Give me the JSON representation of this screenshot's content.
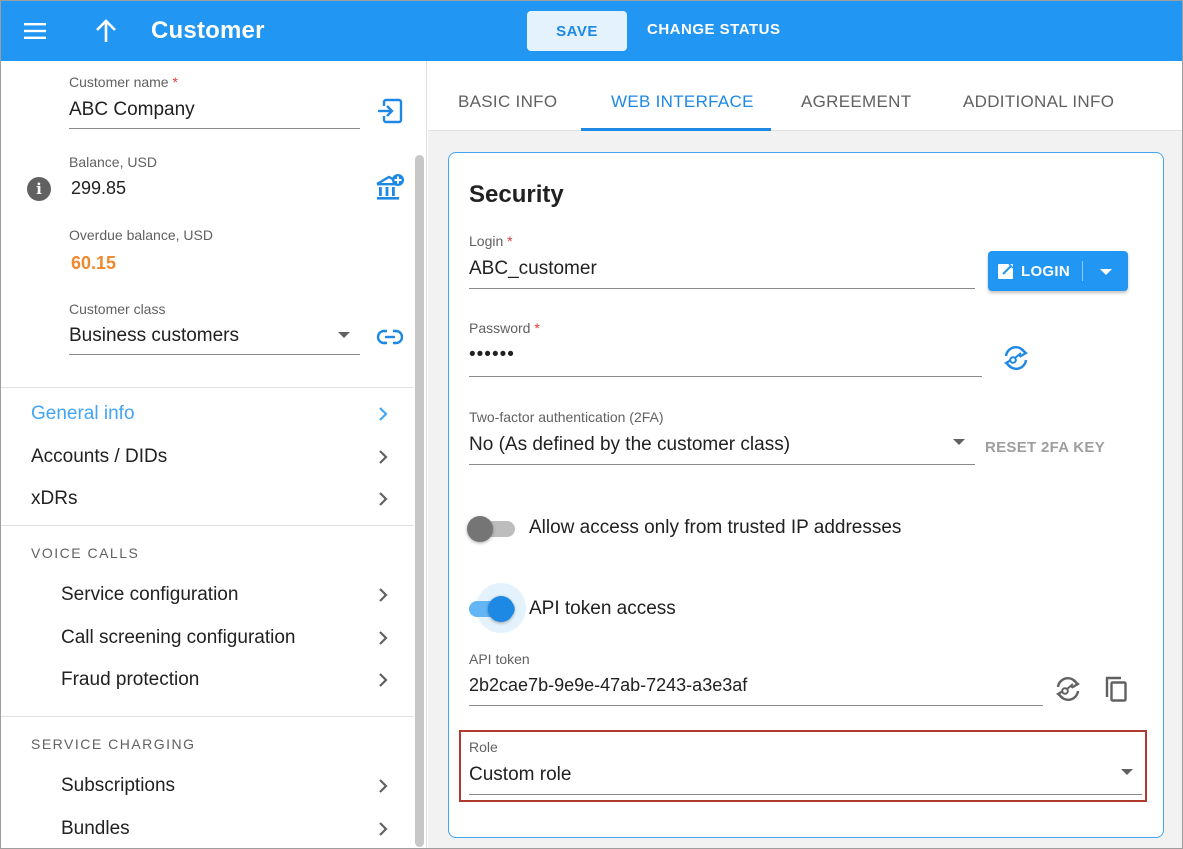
{
  "header": {
    "title": "Customer",
    "save_label": "SAVE",
    "change_status_label": "CHANGE STATUS"
  },
  "sidebar": {
    "customer_name": {
      "label": "Customer name",
      "required": "*",
      "value": "ABC Company"
    },
    "balance": {
      "label": "Balance, USD",
      "value": "299.85"
    },
    "overdue": {
      "label": "Overdue balance, USD",
      "value": "60.15",
      "color": "#f0892e"
    },
    "customer_class": {
      "label": "Customer class",
      "value": "Business customers"
    },
    "nav": [
      {
        "label": "General info",
        "active": true
      },
      {
        "label": "Accounts / DIDs"
      },
      {
        "label": "xDRs"
      }
    ],
    "voice_calls": {
      "header": "VOICE CALLS",
      "items": [
        {
          "label": "Service configuration"
        },
        {
          "label": "Call screening configuration"
        },
        {
          "label": "Fraud protection"
        }
      ]
    },
    "service_charging": {
      "header": "SERVICE CHARGING",
      "items": [
        {
          "label": "Subscriptions"
        },
        {
          "label": "Bundles"
        }
      ]
    }
  },
  "tabs": [
    {
      "label": "BASIC INFO"
    },
    {
      "label": "WEB INTERFACE",
      "active": true
    },
    {
      "label": "AGREEMENT"
    },
    {
      "label": "ADDITIONAL INFO"
    }
  ],
  "security": {
    "title": "Security",
    "login": {
      "label": "Login",
      "required": "*",
      "value": "ABC_customer",
      "button_label": "LOGIN"
    },
    "password": {
      "label": "Password",
      "required": "*",
      "value": "••••••"
    },
    "two_factor": {
      "label": "Two-factor authentication (2FA)",
      "value": "No (As defined by the customer class)",
      "reset_label": "RESET 2FA KEY"
    },
    "trusted_ip": {
      "label": "Allow access only from trusted IP addresses",
      "enabled": false
    },
    "api_access": {
      "label": "API token access",
      "enabled": true
    },
    "api_token": {
      "label": "API token",
      "value": "2b2cae7b-9e9e-47ab-7243-a3e3af"
    },
    "role": {
      "label": "Role",
      "value": "Custom role"
    }
  },
  "colors": {
    "primary": "#2196f3",
    "accent": "#1e88e5",
    "highlight_border": "#b03a2e"
  }
}
